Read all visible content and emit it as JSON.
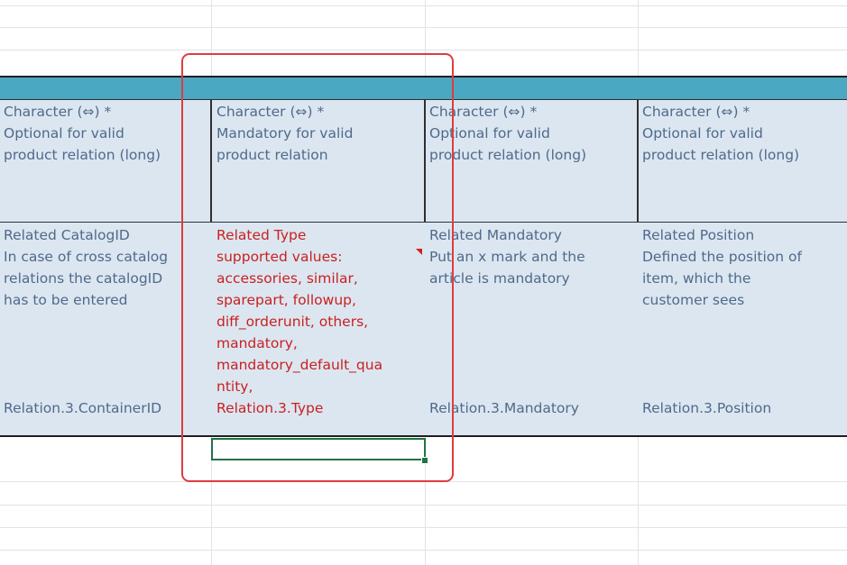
{
  "header_row": [
    {
      "lines": [
        "Character (⇔) *",
        "Optional for valid",
        "product relation (long)"
      ]
    },
    {
      "lines": [
        "Character (⇔) *",
        "Mandatory for valid",
        "product relation"
      ]
    },
    {
      "lines": [
        "Character (⇔) *",
        "Optional for valid",
        "product relation (long)"
      ]
    },
    {
      "lines": [
        "Character (⇔) *",
        "Optional for valid",
        "product relation (long)"
      ]
    }
  ],
  "description_row": [
    {
      "lines": [
        "Related CatalogID",
        "In case of cross catalog",
        "relations the catalogID",
        "has to be entered"
      ]
    },
    {
      "lines": [
        "Related Type",
        "supported values:",
        "accessories, similar,",
        "sparepart, followup,",
        "diff_orderunit, others,",
        "mandatory,",
        "mandatory_default_qua",
        "ntity,"
      ]
    },
    {
      "lines": [
        "Related Mandatory",
        "Put an x mark and the",
        "article is mandatory"
      ]
    },
    {
      "lines": [
        "Related Position",
        "Defined the position of",
        "item, which the",
        "customer sees"
      ]
    }
  ],
  "field_row": [
    "Relation.3.ContainerID",
    "Relation.3.Type",
    "Relation.3.Mandatory",
    "Relation.3.Position"
  ],
  "colors": {
    "header_band": "#4aa8c3",
    "content_band": "#dce6f1",
    "normal_text": "#4f6a8a",
    "highlight_text": "#c8211f",
    "highlight_border": "#e03c3c",
    "selection": "#217346"
  }
}
